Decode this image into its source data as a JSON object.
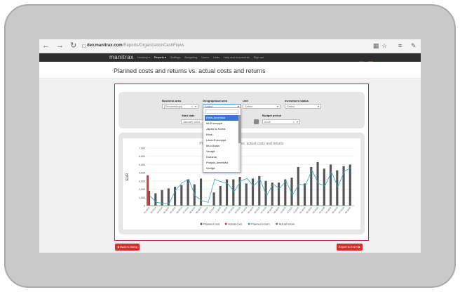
{
  "browser": {
    "url_domain": "dev.manitrax.com",
    "url_path": "/Reports/OrganizationCashFlows"
  },
  "nav": {
    "brand": "manitrax",
    "menu": [
      {
        "label": "Desktop ▾",
        "active": false
      },
      {
        "label": "Reports ▾",
        "active": true
      },
      {
        "label": "Settings",
        "active": false
      },
      {
        "label": "Budgeting",
        "active": false
      },
      {
        "label": "Users",
        "active": false
      },
      {
        "label": "Units",
        "active": false
      },
      {
        "label": "Help and documents",
        "active": false
      },
      {
        "label": "Sign out",
        "active": false
      }
    ]
  },
  "page_title": "Planned costs and returns vs. actual costs and returns",
  "filters": {
    "business_area_label": "Business area",
    "business_area_value": "[Tietoverkkoja]",
    "geo_area_label": "Geographical area",
    "geo_area_value": "Select",
    "unit_label": "Unit",
    "unit_value": "Select",
    "investment_status_label": "Investment status",
    "investment_status_value": "Select",
    "start_date_label": "Start date",
    "start_date_value": "January 2014",
    "budget_period_label": "Budget period",
    "budget_period_value": "2015"
  },
  "geo_dropdown": {
    "items": [
      "Etelä-Amerikka",
      "Itä-Eurooppa",
      "Japani & Korea",
      "Kiina",
      "Länsi-Eurooppa",
      "Muu Aasia",
      "Venäjä",
      "Oseania",
      "Pohjois-Amerikka",
      "Venäjä"
    ],
    "selected_index": 0
  },
  "chart_title": "Planned costs and returns vs. actual costs and returns",
  "chart_data": {
    "type": "bar",
    "ylabel": "EUR",
    "ylim": [
      0,
      7000
    ],
    "yticks": [
      "0",
      "1,000",
      "2,000",
      "3,000",
      "4,000",
      "5,000",
      "6,000",
      "7,000"
    ],
    "categories": [
      "01-2014",
      "02-2014",
      "03-2014",
      "04-2014",
      "05-2014",
      "06-2014",
      "07-2014",
      "08-2014",
      "09-2014",
      "10-2014",
      "11-2014",
      "12-2014",
      "01-2015",
      "02-2015",
      "03-2015",
      "04-2015",
      "05-2015",
      "06-2015",
      "07-2015",
      "08-2015",
      "09-2015",
      "10-2015",
      "11-2015",
      "12-2015",
      "01-2016",
      "02-2016",
      "03-2016",
      "04-2016",
      "05-2016",
      "06-2016",
      "07-2016",
      "08-2016"
    ],
    "series": [
      {
        "name": "Planned cost",
        "color": "#555555",
        "values": [
          1800,
          1500,
          1900,
          2100,
          2300,
          2500,
          3200,
          2600,
          3300,
          0,
          1600,
          2400,
          3200,
          3200,
          3500,
          2700,
          3300,
          3600,
          3000,
          2800,
          2800,
          3200,
          3400,
          4700,
          2700,
          4700,
          5300,
          4500,
          5000,
          4300,
          4800,
          5000
        ]
      },
      {
        "name": "Actual cost",
        "color": "#e53935",
        "values": [
          3700,
          0,
          0,
          0,
          0,
          0,
          0,
          0,
          0,
          0,
          0,
          0,
          0,
          0,
          0,
          0,
          0,
          0,
          0,
          0,
          0,
          0,
          0,
          0,
          0,
          0,
          0,
          0,
          0,
          0,
          0,
          0
        ]
      },
      {
        "name": "Planned return",
        "color": "#2aa8c4",
        "values": [
          1200,
          400,
          300,
          300,
          1900,
          2800,
          3200,
          1200,
          600,
          400,
          3200,
          2900,
          2700,
          1700,
          3000,
          3300,
          2400,
          3200,
          1200,
          2600,
          2100,
          3000,
          1300,
          2600,
          2500,
          4300,
          2700,
          2400,
          4100,
          2300,
          4200,
          4600
        ]
      },
      {
        "name": "Actual return",
        "color": "#43a047",
        "values": [
          0,
          0,
          0,
          0,
          0,
          0,
          0,
          0,
          0,
          0,
          0,
          0,
          0,
          0,
          0,
          0,
          0,
          0,
          0,
          0,
          0,
          0,
          0,
          0,
          0,
          0,
          0,
          0,
          0,
          0,
          0,
          0
        ]
      }
    ]
  },
  "buttons": {
    "back": "Back to listing",
    "export": "Export to Excel"
  },
  "colors": {
    "accent": "#c2185b",
    "button": "#d32f2f",
    "nav_bg": "#2d2d2d"
  }
}
